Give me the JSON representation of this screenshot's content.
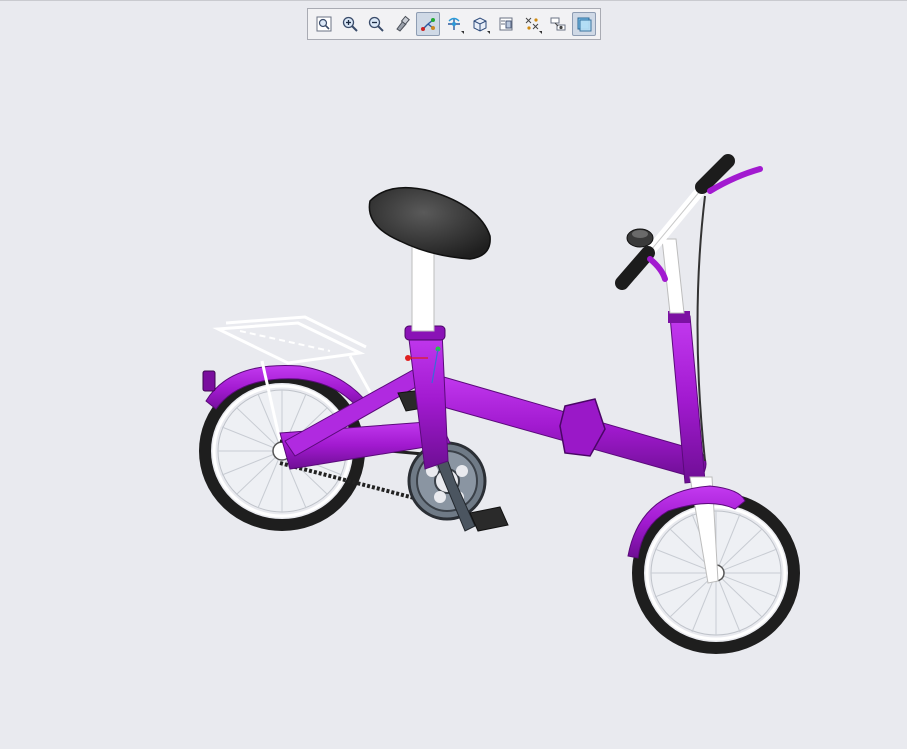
{
  "app": {
    "view": "3d-model-viewport"
  },
  "toolbar": {
    "buttons": [
      {
        "name": "zoom-fit-icon",
        "active": false
      },
      {
        "name": "zoom-in-icon",
        "active": false
      },
      {
        "name": "zoom-out-icon",
        "active": false
      },
      {
        "name": "repaint-icon",
        "active": false
      },
      {
        "name": "datum-display-icon",
        "active": true
      },
      {
        "name": "spin-center-icon",
        "active": false
      },
      {
        "name": "saved-views-icon",
        "active": false
      },
      {
        "name": "view-manager-icon",
        "active": false
      },
      {
        "name": "datum-points-icon",
        "active": false
      },
      {
        "name": "coordinate-system-icon",
        "active": false
      },
      {
        "name": "display-style-icon",
        "active": true
      }
    ]
  },
  "colors": {
    "background": "#e9eaef",
    "frame": "#a21ad0",
    "frame_shade": "#7c11a3",
    "tire": "#222222",
    "saddle": "#2f2f2f",
    "white_parts": "#ffffff",
    "chainring": "#6f7a86"
  }
}
